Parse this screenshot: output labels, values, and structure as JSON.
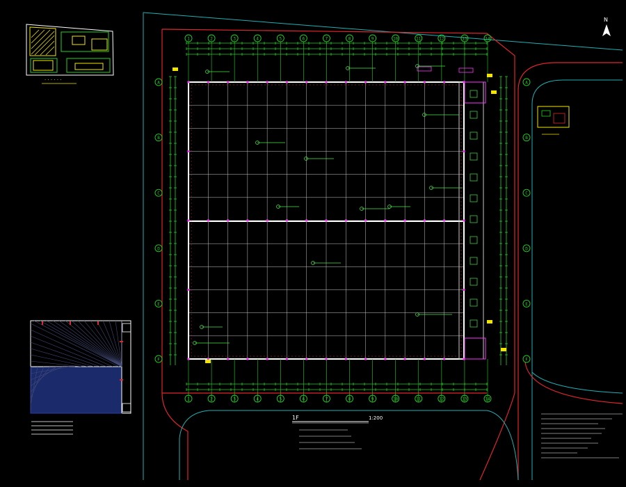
{
  "drawing": {
    "north_label": "N",
    "scale_label": "1:200",
    "plan_title_label": "1F",
    "grid_cols": [
      "1",
      "2",
      "3",
      "4",
      "5",
      "6",
      "7",
      "8",
      "9",
      "10",
      "11",
      "12",
      "13",
      "14"
    ],
    "grid_rows": [
      "A",
      "B",
      "C",
      "D",
      "E",
      "F"
    ]
  },
  "colors": {
    "background": "#000000",
    "grid_line": "#c8c8c8",
    "wall": "#ffffff",
    "boundary_red": "#e0262c",
    "road_cyan": "#21b0b4",
    "dimension_green": "#22d322",
    "annotation_green": "#49e649",
    "magenta_column": "#ff33ff",
    "yellow": "#f2e600",
    "blue_building": "#2a3da8"
  }
}
